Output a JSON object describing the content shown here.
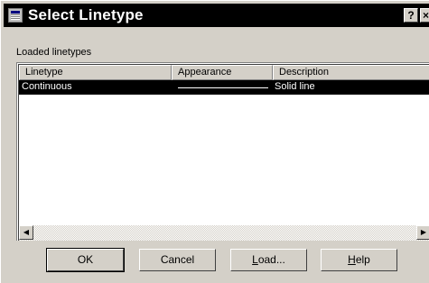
{
  "window": {
    "title": "Select Linetype",
    "help_glyph": "?",
    "close_glyph": "×"
  },
  "section_label": "Loaded linetypes",
  "columns": [
    "Linetype",
    "Appearance",
    "Description"
  ],
  "rows": [
    {
      "linetype": "Continuous",
      "description": "Solid line",
      "selected": true
    }
  ],
  "scrollbar": {
    "left_glyph": "◀",
    "right_glyph": "▶"
  },
  "buttons": {
    "ok": "OK",
    "cancel": "Cancel",
    "load_accel": "L",
    "load_rest": "oad...",
    "help_accel": "H",
    "help_rest": "elp"
  },
  "colors": {
    "face": "#d4d0c8",
    "selection": "#000000",
    "list_bg": "#ffffff"
  }
}
